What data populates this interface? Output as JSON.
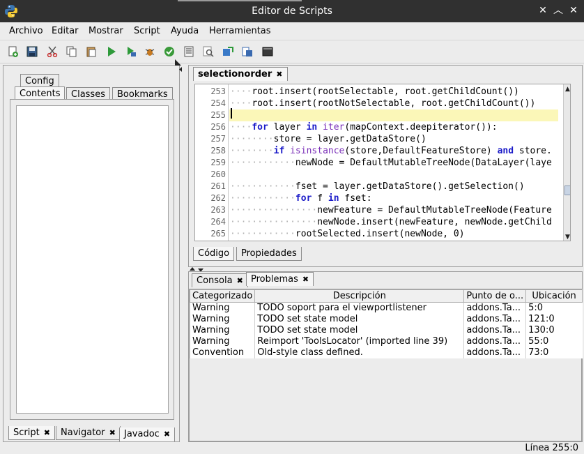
{
  "window": {
    "title": "Editor de Scripts"
  },
  "menu": [
    "Archivo",
    "Editar",
    "Mostrar",
    "Script",
    "Ayuda",
    "Herramientas"
  ],
  "toolbar": [
    "new-script-icon",
    "save-icon",
    "cut-icon",
    "copy-icon",
    "paste-icon",
    "run-icon",
    "run-step-icon",
    "debug-icon",
    "check-icon",
    "list-icon",
    "find-icon",
    "replace-icon",
    "jar-icon",
    "console-icon"
  ],
  "left_panel": {
    "top_tabs": [
      "Config",
      "Contents",
      "Classes",
      "Bookmarks"
    ],
    "bottom_tabs": [
      "Script",
      "Navigator",
      "Javadoc"
    ]
  },
  "editor": {
    "tab": "selectionorder",
    "lines": [
      {
        "n": "253",
        "indent": "····",
        "code": "root.insert(rootSelectable, root.getChildCount())"
      },
      {
        "n": "254",
        "indent": "····",
        "code": "root.insert(rootNotSelectable, root.getChildCount())"
      },
      {
        "n": "255",
        "indent": "",
        "code": ""
      },
      {
        "n": "256",
        "indent": "····",
        "code": "for layer in iter(mapContext.deepiterator()):"
      },
      {
        "n": "257",
        "indent": "········",
        "code": "store = layer.getDataStore()"
      },
      {
        "n": "258",
        "indent": "········",
        "code": "if isinstance(store,DefaultFeatureStore) and store."
      },
      {
        "n": "259",
        "indent": "············",
        "code": "newNode = DefaultMutableTreeNode(DataLayer(laye"
      },
      {
        "n": "260",
        "indent": "",
        "code": ""
      },
      {
        "n": "261",
        "indent": "············",
        "code": "fset = layer.getDataStore().getSelection()"
      },
      {
        "n": "262",
        "indent": "············",
        "code": "for f in fset:"
      },
      {
        "n": "263",
        "indent": "················",
        "code": "newFeature = DefaultMutableTreeNode(Feature"
      },
      {
        "n": "264",
        "indent": "················",
        "code": "newNode.insert(newFeature, newNode.getChild"
      },
      {
        "n": "265",
        "indent": "············",
        "code": "rootSelected.insert(newNode, 0)"
      }
    ],
    "bottom_tabs": [
      "Código",
      "Propiedades"
    ]
  },
  "bottom_panel": {
    "tabs": [
      "Consola",
      "Problemas"
    ],
    "columns": [
      "Categorizado",
      "Descripción",
      "Punto de o...",
      "Ubicación"
    ],
    "rows": [
      [
        "Warning",
        "TODO soport para el viewportlistener",
        "addons.Ta...",
        "5:0"
      ],
      [
        "Warning",
        "TODO set state model",
        "addons.Ta...",
        "121:0"
      ],
      [
        "Warning",
        "TODO set state model",
        "addons.Ta...",
        "130:0"
      ],
      [
        "Warning",
        "Reimport 'ToolsLocator' (imported line 39)",
        "addons.Ta...",
        "55:0"
      ],
      [
        "Convention",
        "Old-style class defined.",
        "addons.Ta...",
        "73:0"
      ]
    ]
  },
  "status": {
    "line": "Línea 255:0"
  }
}
